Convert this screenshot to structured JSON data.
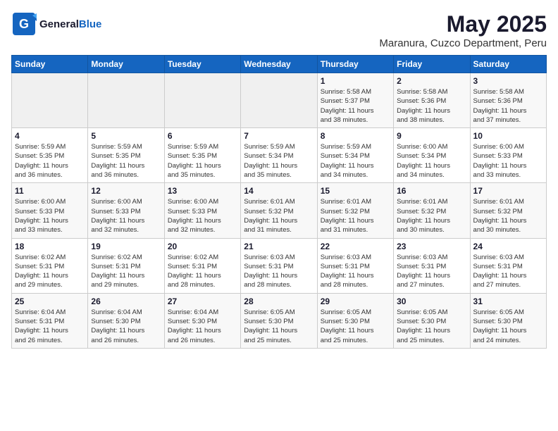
{
  "logo": {
    "general": "General",
    "blue": "Blue"
  },
  "title": "May 2025",
  "subtitle": "Maranura, Cuzco Department, Peru",
  "weekdays": [
    "Sunday",
    "Monday",
    "Tuesday",
    "Wednesday",
    "Thursday",
    "Friday",
    "Saturday"
  ],
  "weeks": [
    [
      {
        "day": "",
        "info": ""
      },
      {
        "day": "",
        "info": ""
      },
      {
        "day": "",
        "info": ""
      },
      {
        "day": "",
        "info": ""
      },
      {
        "day": "1",
        "info": "Sunrise: 5:58 AM\nSunset: 5:37 PM\nDaylight: 11 hours\nand 38 minutes."
      },
      {
        "day": "2",
        "info": "Sunrise: 5:58 AM\nSunset: 5:36 PM\nDaylight: 11 hours\nand 38 minutes."
      },
      {
        "day": "3",
        "info": "Sunrise: 5:58 AM\nSunset: 5:36 PM\nDaylight: 11 hours\nand 37 minutes."
      }
    ],
    [
      {
        "day": "4",
        "info": "Sunrise: 5:59 AM\nSunset: 5:35 PM\nDaylight: 11 hours\nand 36 minutes."
      },
      {
        "day": "5",
        "info": "Sunrise: 5:59 AM\nSunset: 5:35 PM\nDaylight: 11 hours\nand 36 minutes."
      },
      {
        "day": "6",
        "info": "Sunrise: 5:59 AM\nSunset: 5:35 PM\nDaylight: 11 hours\nand 35 minutes."
      },
      {
        "day": "7",
        "info": "Sunrise: 5:59 AM\nSunset: 5:34 PM\nDaylight: 11 hours\nand 35 minutes."
      },
      {
        "day": "8",
        "info": "Sunrise: 5:59 AM\nSunset: 5:34 PM\nDaylight: 11 hours\nand 34 minutes."
      },
      {
        "day": "9",
        "info": "Sunrise: 6:00 AM\nSunset: 5:34 PM\nDaylight: 11 hours\nand 34 minutes."
      },
      {
        "day": "10",
        "info": "Sunrise: 6:00 AM\nSunset: 5:33 PM\nDaylight: 11 hours\nand 33 minutes."
      }
    ],
    [
      {
        "day": "11",
        "info": "Sunrise: 6:00 AM\nSunset: 5:33 PM\nDaylight: 11 hours\nand 33 minutes."
      },
      {
        "day": "12",
        "info": "Sunrise: 6:00 AM\nSunset: 5:33 PM\nDaylight: 11 hours\nand 32 minutes."
      },
      {
        "day": "13",
        "info": "Sunrise: 6:00 AM\nSunset: 5:33 PM\nDaylight: 11 hours\nand 32 minutes."
      },
      {
        "day": "14",
        "info": "Sunrise: 6:01 AM\nSunset: 5:32 PM\nDaylight: 11 hours\nand 31 minutes."
      },
      {
        "day": "15",
        "info": "Sunrise: 6:01 AM\nSunset: 5:32 PM\nDaylight: 11 hours\nand 31 minutes."
      },
      {
        "day": "16",
        "info": "Sunrise: 6:01 AM\nSunset: 5:32 PM\nDaylight: 11 hours\nand 30 minutes."
      },
      {
        "day": "17",
        "info": "Sunrise: 6:01 AM\nSunset: 5:32 PM\nDaylight: 11 hours\nand 30 minutes."
      }
    ],
    [
      {
        "day": "18",
        "info": "Sunrise: 6:02 AM\nSunset: 5:31 PM\nDaylight: 11 hours\nand 29 minutes."
      },
      {
        "day": "19",
        "info": "Sunrise: 6:02 AM\nSunset: 5:31 PM\nDaylight: 11 hours\nand 29 minutes."
      },
      {
        "day": "20",
        "info": "Sunrise: 6:02 AM\nSunset: 5:31 PM\nDaylight: 11 hours\nand 28 minutes."
      },
      {
        "day": "21",
        "info": "Sunrise: 6:03 AM\nSunset: 5:31 PM\nDaylight: 11 hours\nand 28 minutes."
      },
      {
        "day": "22",
        "info": "Sunrise: 6:03 AM\nSunset: 5:31 PM\nDaylight: 11 hours\nand 28 minutes."
      },
      {
        "day": "23",
        "info": "Sunrise: 6:03 AM\nSunset: 5:31 PM\nDaylight: 11 hours\nand 27 minutes."
      },
      {
        "day": "24",
        "info": "Sunrise: 6:03 AM\nSunset: 5:31 PM\nDaylight: 11 hours\nand 27 minutes."
      }
    ],
    [
      {
        "day": "25",
        "info": "Sunrise: 6:04 AM\nSunset: 5:31 PM\nDaylight: 11 hours\nand 26 minutes."
      },
      {
        "day": "26",
        "info": "Sunrise: 6:04 AM\nSunset: 5:30 PM\nDaylight: 11 hours\nand 26 minutes."
      },
      {
        "day": "27",
        "info": "Sunrise: 6:04 AM\nSunset: 5:30 PM\nDaylight: 11 hours\nand 26 minutes."
      },
      {
        "day": "28",
        "info": "Sunrise: 6:05 AM\nSunset: 5:30 PM\nDaylight: 11 hours\nand 25 minutes."
      },
      {
        "day": "29",
        "info": "Sunrise: 6:05 AM\nSunset: 5:30 PM\nDaylight: 11 hours\nand 25 minutes."
      },
      {
        "day": "30",
        "info": "Sunrise: 6:05 AM\nSunset: 5:30 PM\nDaylight: 11 hours\nand 25 minutes."
      },
      {
        "day": "31",
        "info": "Sunrise: 6:05 AM\nSunset: 5:30 PM\nDaylight: 11 hours\nand 24 minutes."
      }
    ]
  ]
}
